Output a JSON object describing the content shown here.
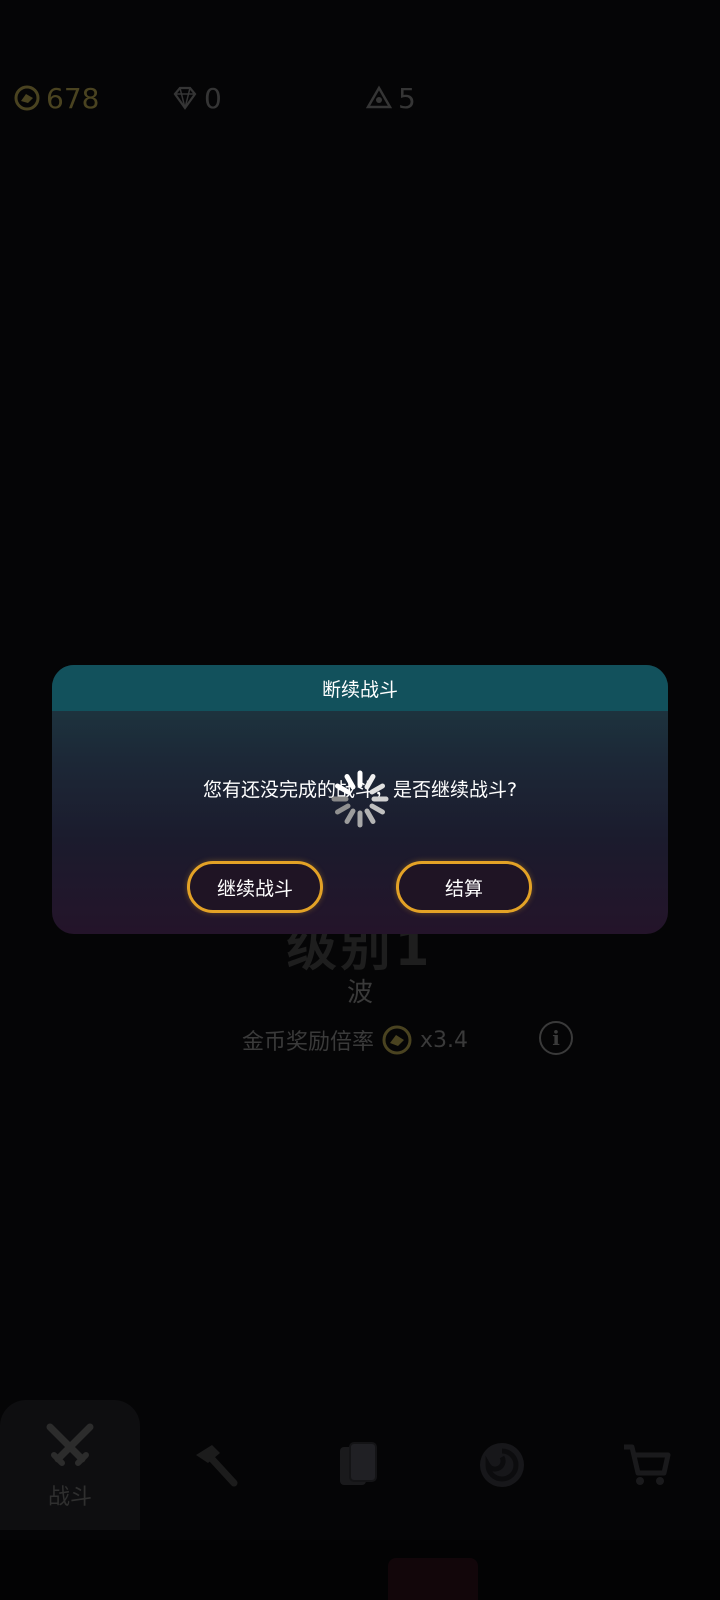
{
  "currency": {
    "coins": "678",
    "gems": "0",
    "tokens": "5"
  },
  "background": {
    "level_text": "级别1",
    "wave_text": "波",
    "reward_label": "金币奖励倍率",
    "reward_multiplier": "x3.4",
    "info_icon": "i"
  },
  "bottom_nav": {
    "items": [
      {
        "label": "战斗",
        "icon": "crossed-swords-icon"
      },
      {
        "label": "",
        "icon": "hammer-icon"
      },
      {
        "label": "",
        "icon": "cards-icon"
      },
      {
        "label": "",
        "icon": "swirl-icon"
      },
      {
        "label": "",
        "icon": "cart-icon"
      }
    ]
  },
  "dialog": {
    "title": "断续战斗",
    "message": "您有还没完成的战斗，是否继续战斗?",
    "continue_label": "继续战斗",
    "settle_label": "结算"
  },
  "colors": {
    "accent_button_border": "#e3a226",
    "dialog_header": "#12515c"
  }
}
